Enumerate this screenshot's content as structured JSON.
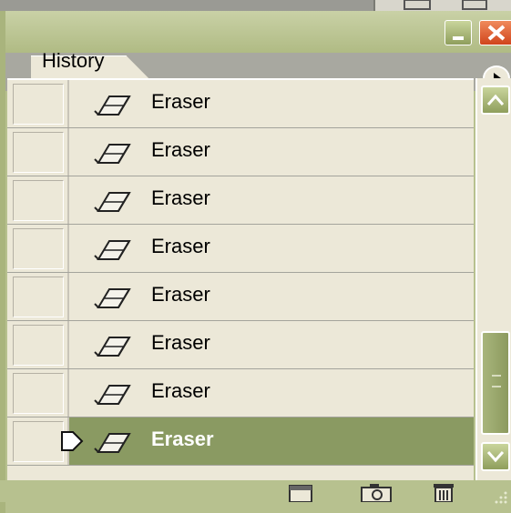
{
  "panel": {
    "tab_label": "History",
    "items": [
      {
        "label": "Eraser",
        "icon": "eraser-icon",
        "selected": false
      },
      {
        "label": "Eraser",
        "icon": "eraser-icon",
        "selected": false
      },
      {
        "label": "Eraser",
        "icon": "eraser-icon",
        "selected": false
      },
      {
        "label": "Eraser",
        "icon": "eraser-icon",
        "selected": false
      },
      {
        "label": "Eraser",
        "icon": "eraser-icon",
        "selected": false
      },
      {
        "label": "Eraser",
        "icon": "eraser-icon",
        "selected": false
      },
      {
        "label": "Eraser",
        "icon": "eraser-icon",
        "selected": false
      },
      {
        "label": "Eraser",
        "icon": "eraser-icon",
        "selected": true
      }
    ],
    "footer_buttons": [
      "new-document-icon",
      "camera-icon",
      "trash-icon"
    ],
    "colors": {
      "titlebar": "#b7c18f",
      "list_bg": "#ece8d8",
      "selected_row": "#8a9a62",
      "close_button": "#d0451c"
    }
  }
}
